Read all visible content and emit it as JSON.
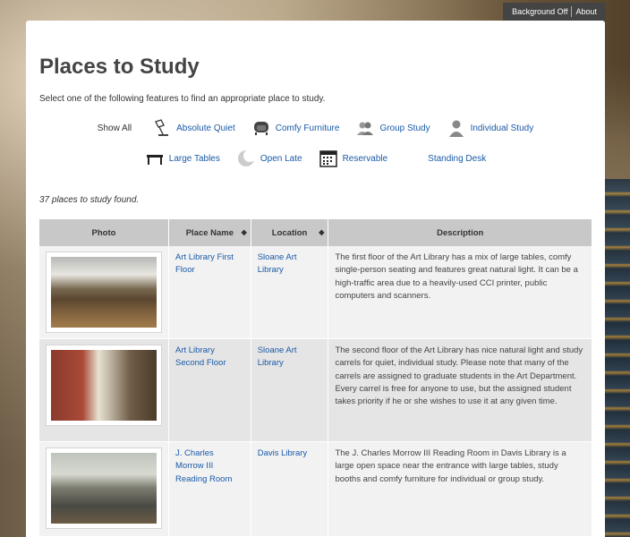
{
  "top_links": {
    "background_toggle": "Background Off",
    "about": "About"
  },
  "page": {
    "title": "Places to Study",
    "intro": "Select one of the following features to find an appropriate place to study.",
    "show_all": "Show All",
    "filters_row1": [
      {
        "label": "Absolute Quiet",
        "icon": "lamp-icon"
      },
      {
        "label": "Comfy Furniture",
        "icon": "armchair-icon"
      },
      {
        "label": "Group Study",
        "icon": "group-icon"
      },
      {
        "label": "Individual Study",
        "icon": "person-icon"
      }
    ],
    "filters_row2": [
      {
        "label": "Large Tables",
        "icon": "table-icon"
      },
      {
        "label": "Open Late",
        "icon": "moon-icon"
      },
      {
        "label": "Reservable",
        "icon": "calendar-icon"
      },
      {
        "label": "Standing Desk",
        "icon": ""
      }
    ],
    "found_text": "37 places to study found."
  },
  "table": {
    "headers": {
      "photo": "Photo",
      "place": "Place Name",
      "location": "Location",
      "description": "Description"
    },
    "sort_glyph": "◆",
    "rows": [
      {
        "place": "Art Library First Floor",
        "location": "Sloane Art Library",
        "description": "The first floor of the Art Library has a mix of large tables, comfy single-person seating and features great natural light. It can be a high-traffic area due to a heavily-used CCI printer, public computers and scanners."
      },
      {
        "place": "Art Library Second Floor",
        "location": "Sloane Art Library",
        "description": "The second floor of the Art Library has nice natural light and study carrels for quiet, individual study. Please note that many of the carrels are assigned to graduate students in the Art Department. Every carrel is free for anyone to use, but the assigned student takes priority if he or she wishes to use it at any given time."
      },
      {
        "place": "J. Charles Morrow III Reading Room",
        "location": "Davis Library",
        "description": "The J. Charles Morrow III Reading Room in Davis Library is a large open space near the entrance with large tables, study booths and comfy furniture for individual or group study."
      }
    ]
  }
}
